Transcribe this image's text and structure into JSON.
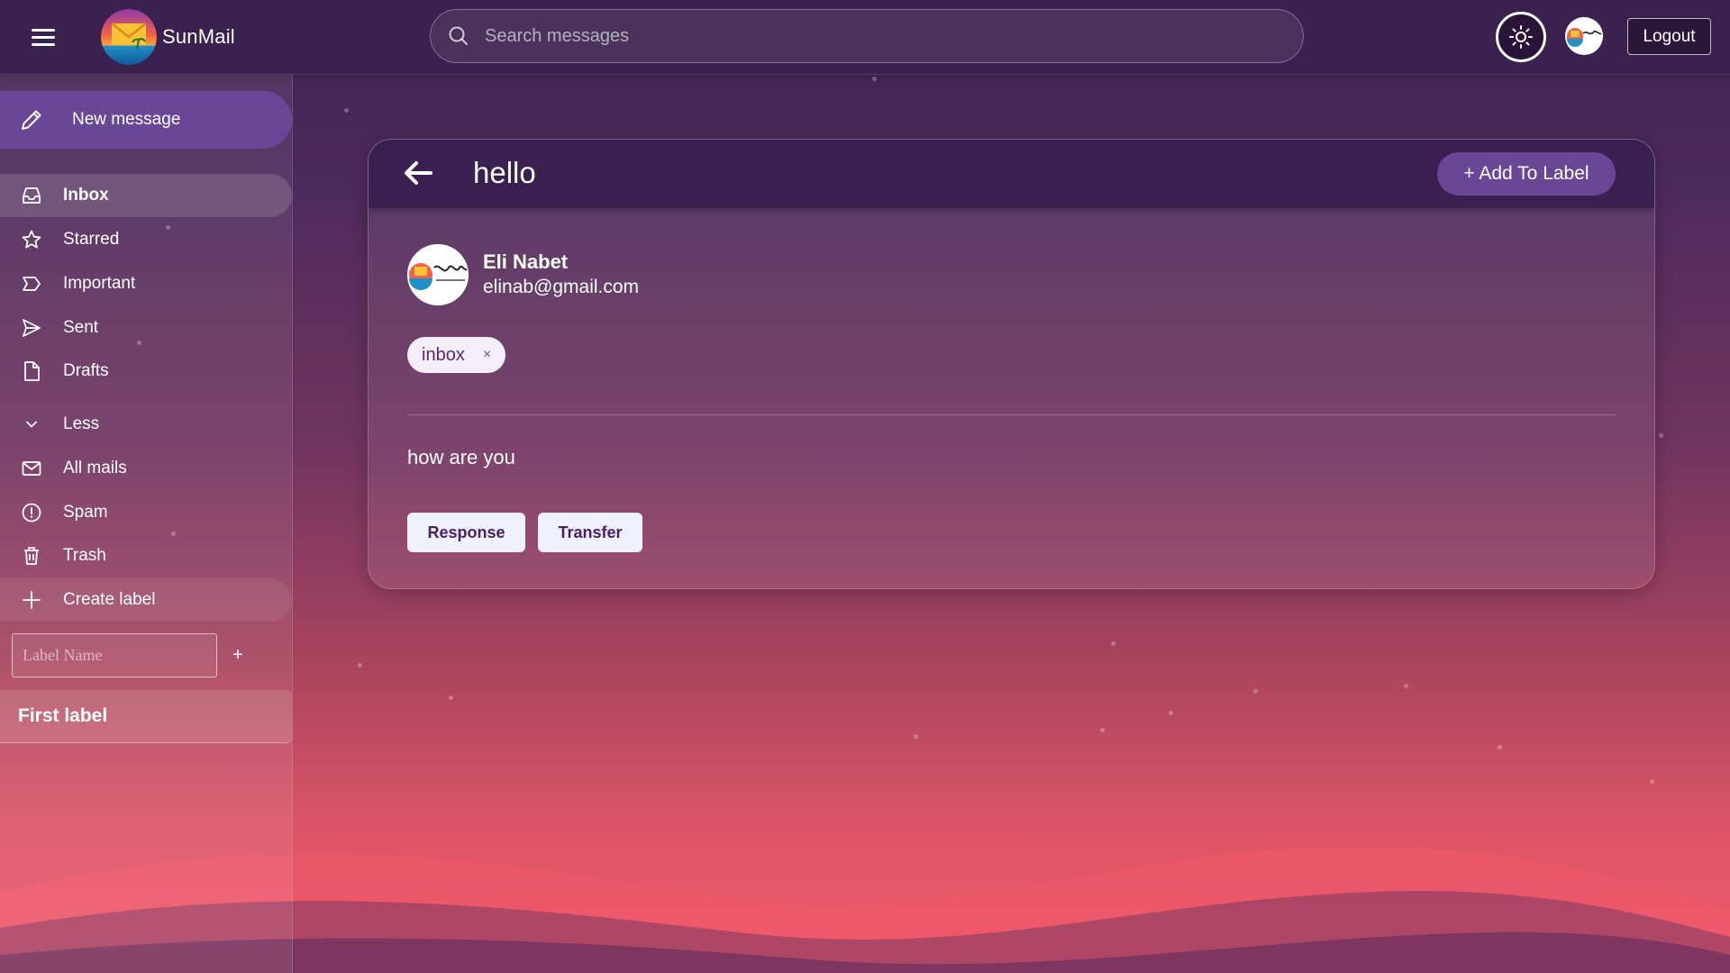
{
  "app": {
    "name": "SunMail"
  },
  "search": {
    "placeholder": "Search messages",
    "value": ""
  },
  "header": {
    "logout_label": "Logout"
  },
  "sidebar": {
    "compose_label": "New message",
    "items": [
      {
        "id": "inbox",
        "label": "Inbox",
        "icon": "inbox-icon",
        "active": true
      },
      {
        "id": "starred",
        "label": "Starred",
        "icon": "star-icon"
      },
      {
        "id": "important",
        "label": "Important",
        "icon": "important-icon"
      },
      {
        "id": "sent",
        "label": "Sent",
        "icon": "send-icon"
      },
      {
        "id": "drafts",
        "label": "Drafts",
        "icon": "file-icon"
      },
      {
        "id": "less",
        "label": "Less",
        "icon": "chevron-down-icon"
      },
      {
        "id": "all-mails",
        "label": "All mails",
        "icon": "envelope-icon"
      },
      {
        "id": "spam",
        "label": "Spam",
        "icon": "alert-circle-icon"
      },
      {
        "id": "trash",
        "label": "Trash",
        "icon": "trash-icon"
      },
      {
        "id": "create-label",
        "label": "Create label",
        "icon": "plus-icon"
      }
    ],
    "label_input_placeholder": "Label Name",
    "label_add": "+",
    "user_labels": [
      "First label"
    ]
  },
  "message": {
    "subject": "hello",
    "add_label_button": "+ Add To Label",
    "sender_name": "Eli Nabet",
    "sender_email": "elinab@gmail.com",
    "labels": [
      {
        "name": "inbox",
        "remove": "×"
      }
    ],
    "body": "how are you",
    "actions": {
      "response": "Response",
      "transfer": "Transfer"
    }
  },
  "colors": {
    "accent": "#6a4697",
    "topbar": "#3b2150",
    "button_bg": "#eef0fb",
    "button_text": "#4a2066"
  }
}
